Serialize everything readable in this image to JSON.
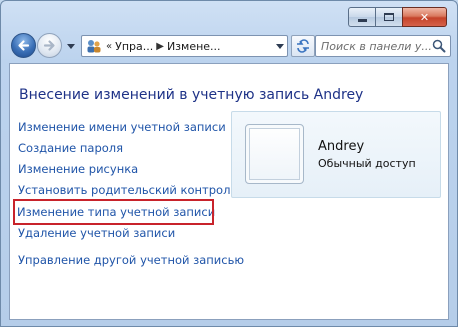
{
  "window": {
    "caption": {
      "minimize_label": "",
      "maximize_label": "",
      "close_label": "✕"
    }
  },
  "toolbar": {
    "breadcrumb": {
      "overflow": "«",
      "items": [
        "Упра...",
        "Измене..."
      ]
    },
    "search": {
      "placeholder": "Поиск в панели у..."
    }
  },
  "main": {
    "title": "Внесение изменений в учетную запись Andrey",
    "links": [
      "Изменение имени учетной записи",
      "Создание пароля",
      "Изменение рисунка",
      "Установить родительский контроль",
      "Изменение типа учетной записи",
      "Удаление учетной записи",
      "Управление другой учетной записью"
    ],
    "highlighted_link_index": 4,
    "highlight_color": "#c8232b",
    "link_color": "#1f54a8",
    "title_color": "#1e3287"
  },
  "account": {
    "name": "Andrey",
    "type": "Обычный доступ"
  },
  "icons": {
    "back": "back-arrow-icon",
    "forward": "forward-arrow-icon",
    "address": "control-panel-users-icon",
    "refresh": "refresh-icon",
    "search": "search-icon"
  }
}
